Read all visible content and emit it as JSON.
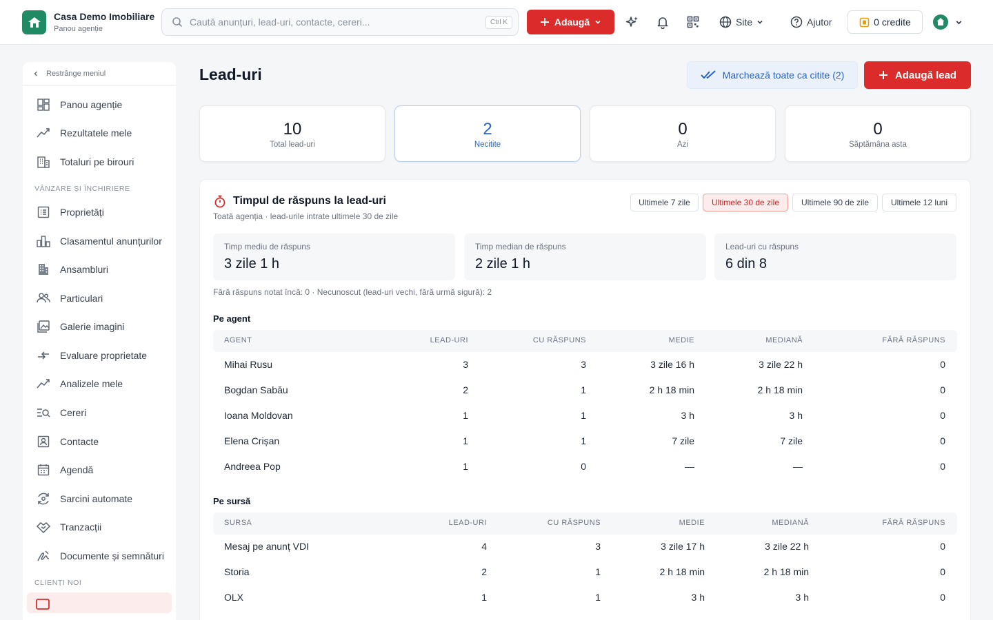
{
  "brand": {
    "name": "Casa Demo Imobiliare",
    "subtitle": "Panou agenție"
  },
  "search": {
    "placeholder": "Caută anunțuri, lead-uri, contacte, cereri...",
    "shortcut": "Ctrl K"
  },
  "topbar": {
    "add_label": "Adaugă",
    "site_label": "Site",
    "help_label": "Ajutor",
    "credits_label": "0  credite"
  },
  "sidebar": {
    "collapse_label": "Restrânge meniul",
    "items": [
      {
        "label": "Panou agenție",
        "icon": "dashboard-icon"
      },
      {
        "label": "Rezultatele mele",
        "icon": "chart-line-icon"
      },
      {
        "label": "Totaluri pe birouri",
        "icon": "office-icon"
      },
      {
        "label": "Proprietăți",
        "icon": "list-icon"
      },
      {
        "label": "Clasamentul anunțurilor",
        "icon": "bar-chart-icon"
      },
      {
        "label": "Ansambluri",
        "icon": "building-icon"
      },
      {
        "label": "Particulari",
        "icon": "users-icon"
      },
      {
        "label": "Galerie imagini",
        "icon": "image-icon"
      },
      {
        "label": "Evaluare proprietate",
        "icon": "swap-icon"
      },
      {
        "label": "Analizele mele",
        "icon": "chart-line-icon"
      },
      {
        "label": "Cereri",
        "icon": "search-list-icon"
      },
      {
        "label": "Contacte",
        "icon": "contact-icon"
      },
      {
        "label": "Agendă",
        "icon": "calendar-icon"
      },
      {
        "label": "Sarcini automate",
        "icon": "automation-icon"
      },
      {
        "label": "Tranzacții",
        "icon": "handshake-icon"
      },
      {
        "label": "Documente și semnături",
        "icon": "signature-icon"
      }
    ],
    "sections": [
      "VÂNZARE ȘI ÎNCHIRIERE",
      "CLIENȚI NOI"
    ]
  },
  "page": {
    "title": "Lead-uri",
    "mark_all_label": "Marchează toate ca citite (2)",
    "add_lead_label": "Adaugă lead"
  },
  "stats": [
    {
      "value": "10",
      "label": "Total lead-uri"
    },
    {
      "value": "2",
      "label": "Necitite"
    },
    {
      "value": "0",
      "label": "Azi"
    },
    {
      "value": "0",
      "label": "Săptămâna asta"
    }
  ],
  "response": {
    "title": "Timpul de răspuns la lead-uri",
    "subtitle": "Toată agenția · lead-urile intrate ultimele 30 de zile",
    "ranges": [
      "Ultimele 7 zile",
      "Ultimele 30 de zile",
      "Ultimele 90 de zile",
      "Ultimele 12 luni"
    ],
    "metrics": [
      {
        "label": "Timp mediu de răspuns",
        "value": "3 zile 1 h"
      },
      {
        "label": "Timp median de răspuns",
        "value": "2 zile 1 h"
      },
      {
        "label": "Lead-uri cu răspuns",
        "value": "6 din 8"
      }
    ],
    "note": "Fără răspuns notat încă: 0 · Necunoscut (lead-uri vechi, fără urmă sigură): 2"
  },
  "by_agent": {
    "title": "Pe agent",
    "headers": [
      "AGENT",
      "LEAD-URI",
      "CU RĂSPUNS",
      "MEDIE",
      "MEDIANĂ",
      "FĂRĂ RĂSPUNS"
    ],
    "rows": [
      [
        "Mihai Rusu",
        "3",
        "3",
        "3 zile 16 h",
        "3 zile 22 h",
        "0"
      ],
      [
        "Bogdan Sabău",
        "2",
        "1",
        "2 h 18 min",
        "2 h 18 min",
        "0"
      ],
      [
        "Ioana Moldovan",
        "1",
        "1",
        "3 h",
        "3 h",
        "0"
      ],
      [
        "Elena Crișan",
        "1",
        "1",
        "7 zile",
        "7 zile",
        "0"
      ],
      [
        "Andreea Pop",
        "1",
        "0",
        "—",
        "—",
        "0"
      ]
    ]
  },
  "by_source": {
    "title": "Pe sursă",
    "headers": [
      "SURSA",
      "LEAD-URI",
      "CU RĂSPUNS",
      "MEDIE",
      "MEDIANĂ",
      "FĂRĂ RĂSPUNS"
    ],
    "rows": [
      [
        "Mesaj pe anunț VDI",
        "4",
        "3",
        "3 zile 17 h",
        "3 zile 22 h",
        "0"
      ],
      [
        "Storia",
        "2",
        "1",
        "2 h 18 min",
        "2 h 18 min",
        "0"
      ],
      [
        "OLX",
        "1",
        "1",
        "3 h",
        "3 h",
        "0"
      ]
    ]
  },
  "colors": {
    "accent_red": "#dc2b2b",
    "accent_blue": "#2563c9",
    "brand_green": "#1f8a63"
  }
}
